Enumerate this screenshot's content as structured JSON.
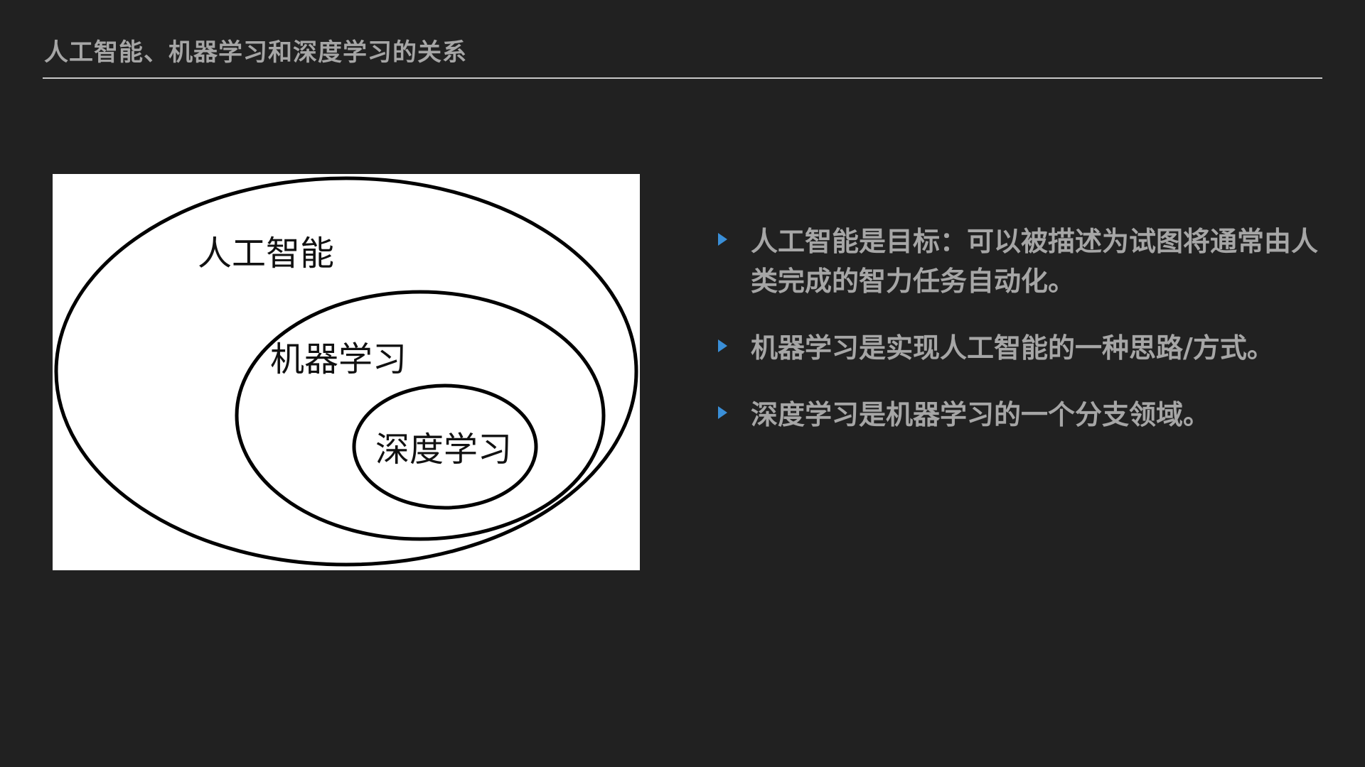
{
  "slide": {
    "title": "人工智能、机器学习和深度学习的关系"
  },
  "diagram": {
    "outer_label": "人工智能",
    "middle_label": "机器学习",
    "inner_label": "深度学习"
  },
  "bullets": [
    {
      "text": "人工智能是目标：可以被描述为试图将通常由人类完成的智力任务自动化。"
    },
    {
      "text": "机器学习是实现人工智能的一种思路/方式。"
    },
    {
      "text": "深度学习是机器学习的一个分支领域。"
    }
  ],
  "colors": {
    "background": "#212121",
    "text": "#a6a6a6",
    "bullet_marker": "#3a8fd8",
    "diagram_background": "#ffffff",
    "diagram_stroke": "#000000"
  },
  "icons": {
    "bullet": "triangle-right-icon"
  }
}
